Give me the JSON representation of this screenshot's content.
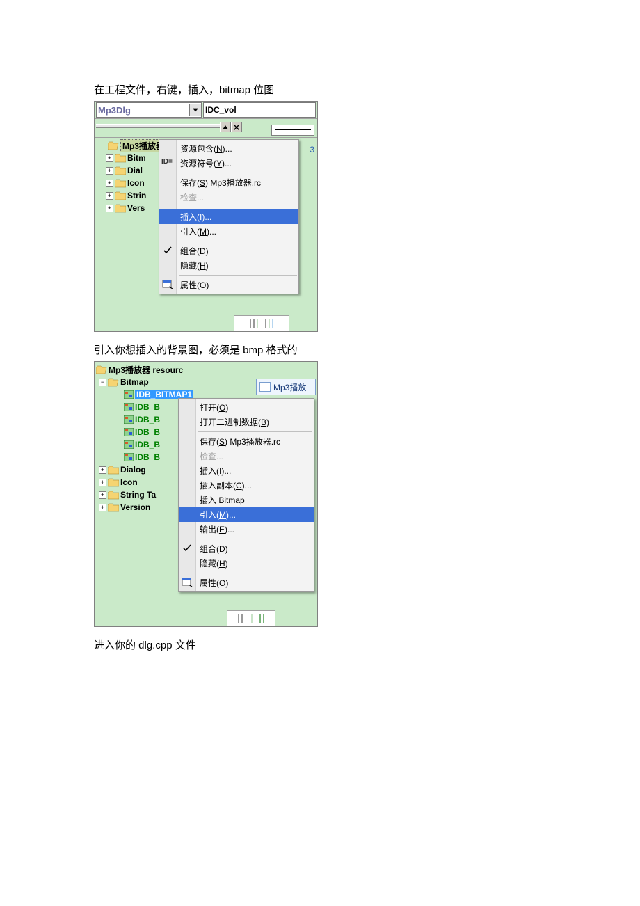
{
  "doc": {
    "para1": "在工程文件，右键，插入，bitmap 位图",
    "para2": "引入你想插入的背景图，必须是 bmp 格式的",
    "para3": "进入你的 dlg.cpp 文件"
  },
  "shot1": {
    "combo_text": "Mp3Dlg",
    "idc_text": "IDC_vol",
    "right_num": "3",
    "tree_root": "Mp3播放器",
    "tree": {
      "bitmap": "Bitm",
      "dialog": "Dial",
      "icon": "Icon",
      "string": "Strin",
      "version": "Vers"
    },
    "id_prefix": "ID=",
    "menu": {
      "res_include_pre": "资源包含(",
      "res_include_accel": "N",
      "res_include_post": ")...",
      "res_symbol_pre": "资源符号(",
      "res_symbol_accel": "Y",
      "res_symbol_post": ")...",
      "save_pre": "保存(",
      "save_accel": "S",
      "save_post": ") Mp3播放器.rc",
      "check": "检查...",
      "insert_pre": "插入(",
      "insert_accel": "I",
      "insert_post": ")...",
      "import_pre": "引入(",
      "import_accel": "M",
      "import_post": ")...",
      "group_pre": "组合(",
      "group_accel": "D",
      "group_post": ")",
      "hide_pre": "隐藏(",
      "hide_accel": "H",
      "hide_post": ")",
      "prop_pre": "属性(",
      "prop_accel": "O",
      "prop_post": ")"
    }
  },
  "shot2": {
    "tab_label": "Mp3播放",
    "tree_root": "Mp3播放器 resourc",
    "tree": {
      "bitmap": "Bitmap",
      "idb_sel": "IDB_BITMAP1",
      "idb": "IDB_B",
      "dialog": "Dialog",
      "icon": "Icon",
      "string": "String Ta",
      "version": "Version"
    },
    "menu": {
      "open_pre": "打开(",
      "open_accel": "O",
      "open_post": ")",
      "openbin_pre": "打开二进制数据(",
      "openbin_accel": "B",
      "openbin_post": ")",
      "save_pre": "保存(",
      "save_accel": "S",
      "save_post": ") Mp3播放器.rc",
      "check": "检查...",
      "insert_pre": "插入(",
      "insert_accel": "I",
      "insert_post": ")...",
      "insertcopy_pre": "插入副本(",
      "insertcopy_accel": "C",
      "insertcopy_post": ")...",
      "insertbmp": "插入 Bitmap",
      "import_pre": "引入(",
      "import_accel": "M",
      "import_post": ")...",
      "export_pre": "输出(",
      "export_accel": "E",
      "export_post": ")...",
      "group_pre": "组合(",
      "group_accel": "D",
      "group_post": ")",
      "hide_pre": "隐藏(",
      "hide_accel": "H",
      "hide_post": ")",
      "prop_pre": "属性(",
      "prop_accel": "O",
      "prop_post": ")"
    }
  }
}
